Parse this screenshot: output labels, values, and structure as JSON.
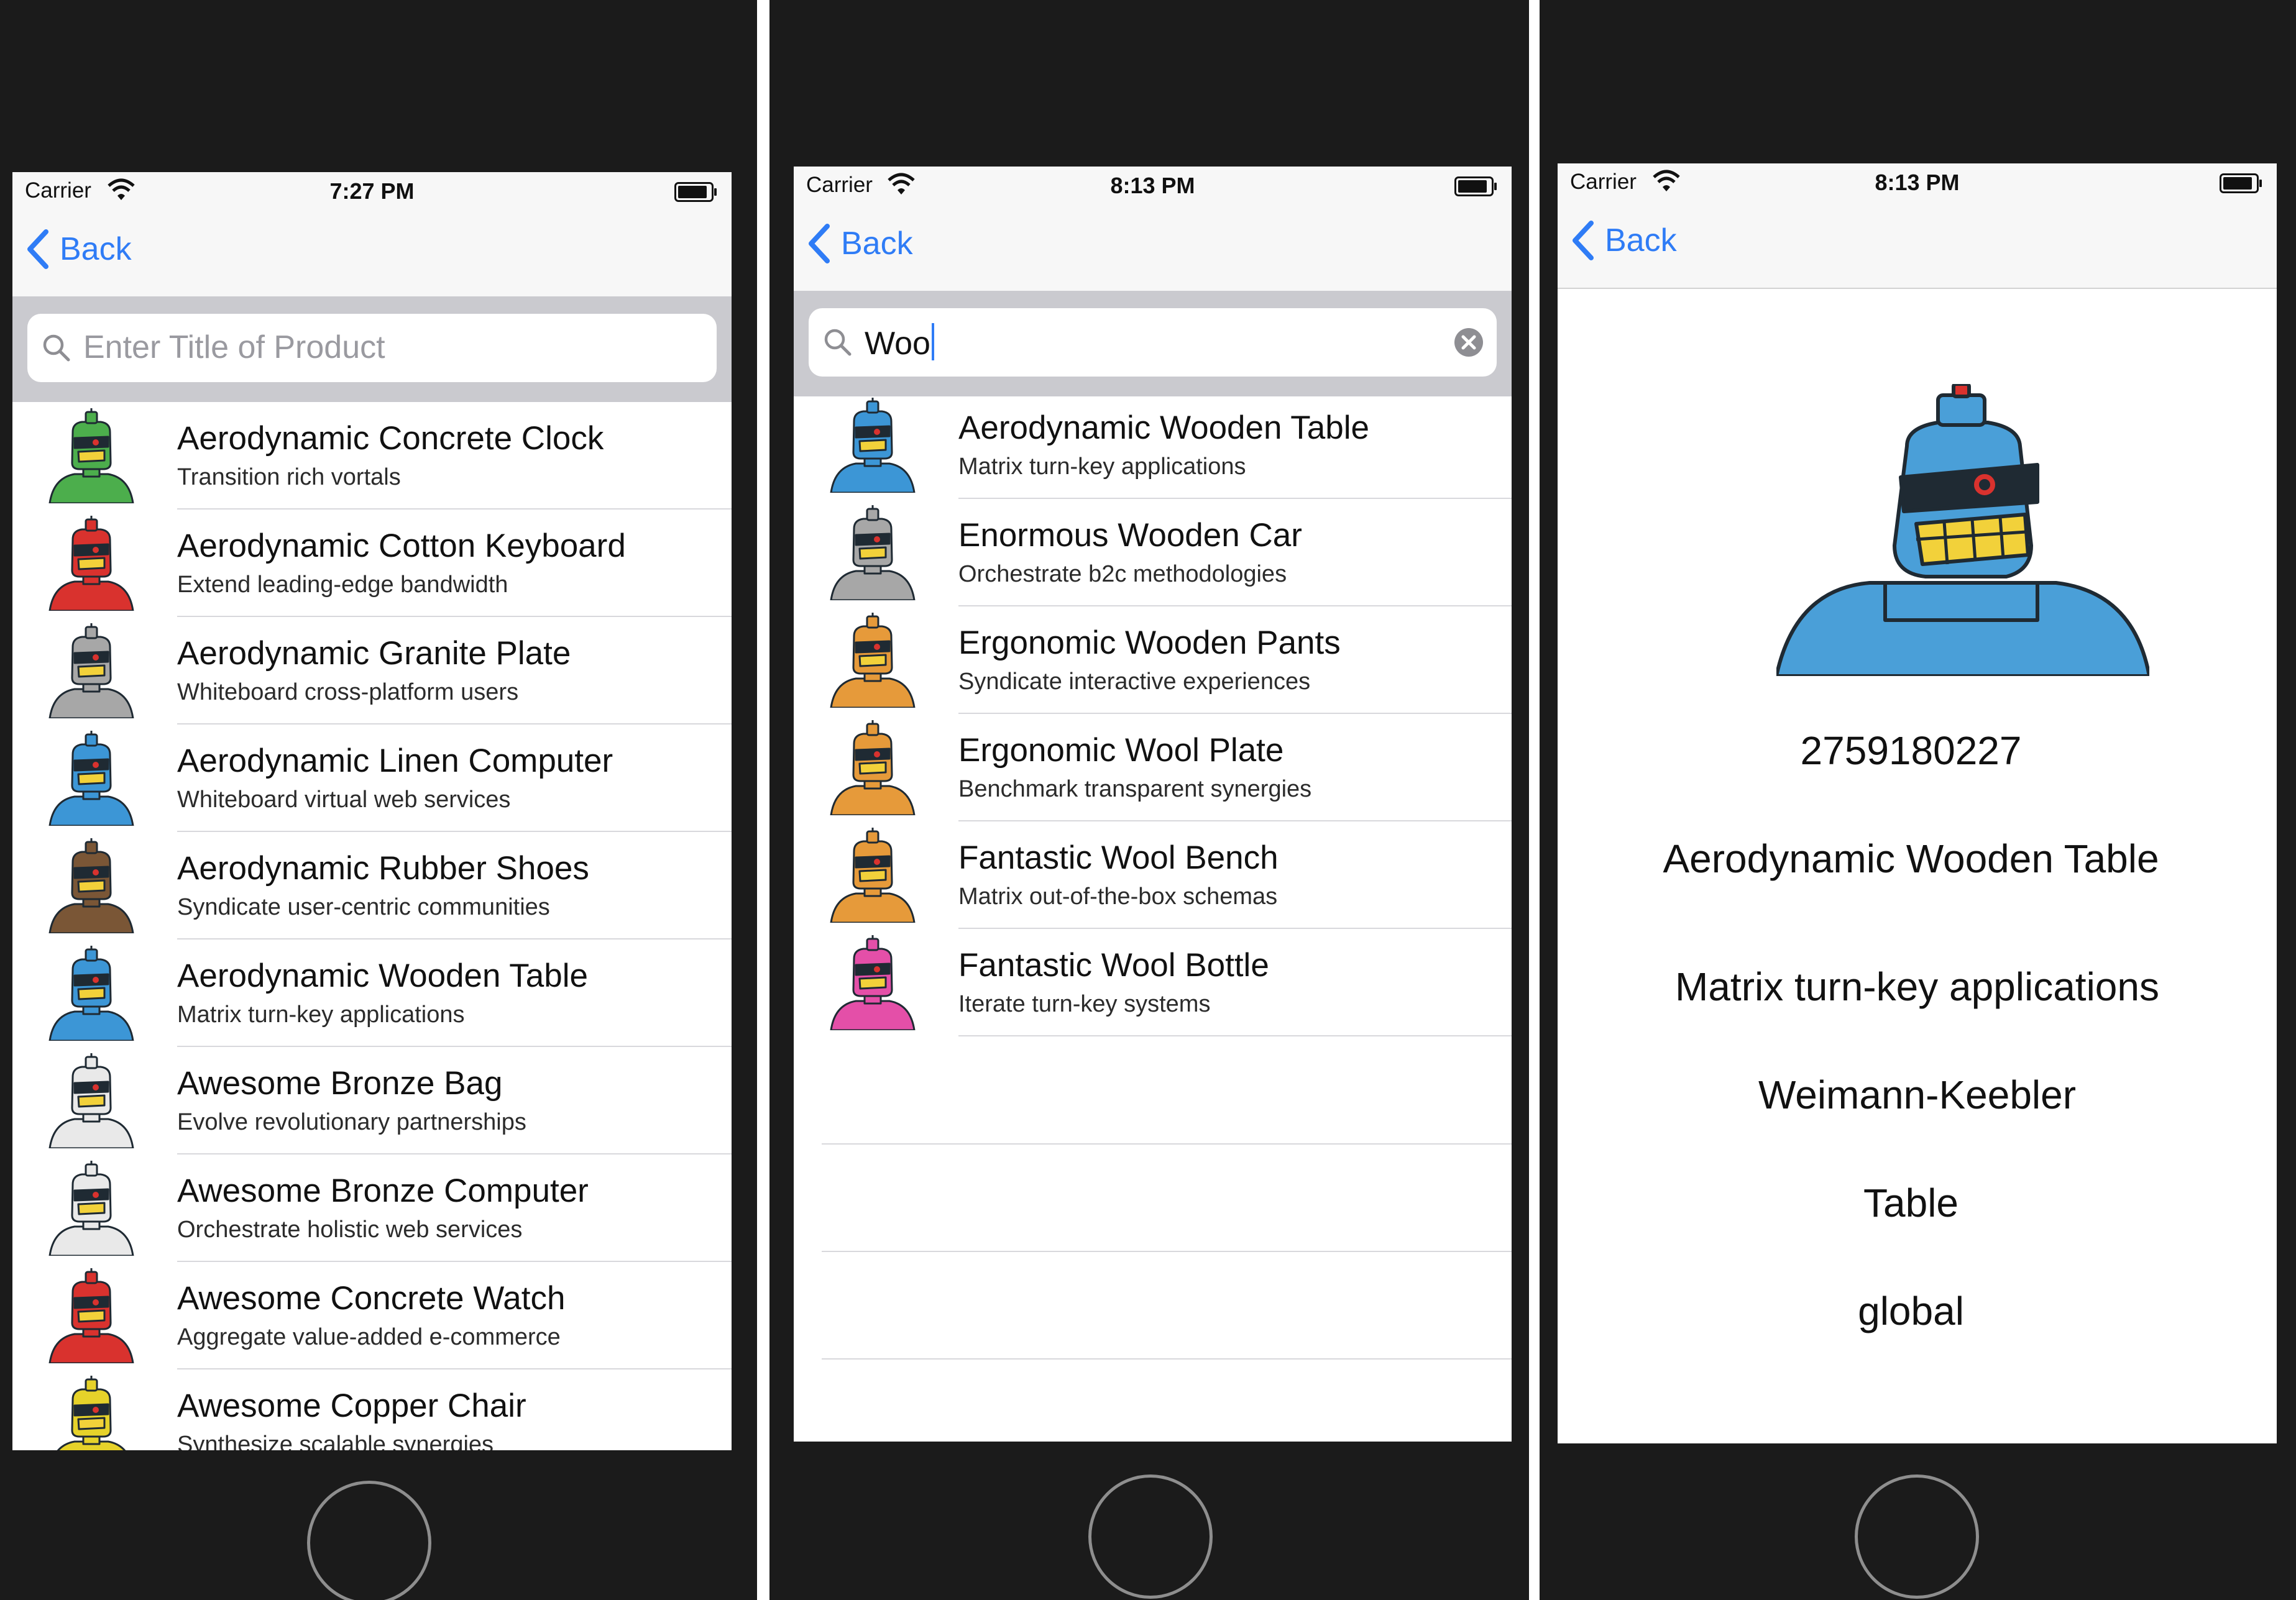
{
  "status": {
    "carrier": "Carrier"
  },
  "nav": {
    "back_label": "Back"
  },
  "screen1": {
    "time": "7:27 PM",
    "search_placeholder": "Enter Title of Product",
    "rows": [
      {
        "title": "Aerodynamic Concrete Clock",
        "subtitle": "Transition rich vortals",
        "color": "#4cae4c"
      },
      {
        "title": "Aerodynamic Cotton Keyboard",
        "subtitle": "Extend leading-edge bandwidth",
        "color": "#d9322e"
      },
      {
        "title": "Aerodynamic Granite Plate",
        "subtitle": "Whiteboard cross-platform users",
        "color": "#a7a7a7"
      },
      {
        "title": "Aerodynamic Linen Computer",
        "subtitle": "Whiteboard virtual web services",
        "color": "#3c96d6"
      },
      {
        "title": "Aerodynamic Rubber Shoes",
        "subtitle": "Syndicate user-centric communities",
        "color": "#7a5636"
      },
      {
        "title": "Aerodynamic Wooden Table",
        "subtitle": "Matrix turn-key applications",
        "color": "#3c96d6"
      },
      {
        "title": "Awesome Bronze Bag",
        "subtitle": "Evolve revolutionary partnerships",
        "color": "#e9e9e9"
      },
      {
        "title": "Awesome Bronze Computer",
        "subtitle": "Orchestrate holistic web services",
        "color": "#e9e9e9"
      },
      {
        "title": "Awesome Concrete Watch",
        "subtitle": "Aggregate value-added e-commerce",
        "color": "#d9322e"
      },
      {
        "title": "Awesome Copper Chair",
        "subtitle": "Synthesize scalable synergies",
        "color": "#e6d22a"
      }
    ]
  },
  "screen2": {
    "time": "8:13 PM",
    "search_value": "Woo",
    "rows": [
      {
        "title": "Aerodynamic Wooden Table",
        "subtitle": "Matrix turn-key applications",
        "color": "#3c96d6"
      },
      {
        "title": "Enormous Wooden Car",
        "subtitle": "Orchestrate b2c methodologies",
        "color": "#a7a7a7"
      },
      {
        "title": "Ergonomic Wooden Pants",
        "subtitle": "Syndicate interactive experiences",
        "color": "#e69a3a"
      },
      {
        "title": "Ergonomic Wool Plate",
        "subtitle": "Benchmark transparent synergies",
        "color": "#e69a3a"
      },
      {
        "title": "Fantastic Wool Bench",
        "subtitle": "Matrix out-of-the-box schemas",
        "color": "#e69a3a"
      },
      {
        "title": "Fantastic Wool Bottle",
        "subtitle": "Iterate turn-key systems",
        "color": "#e44fa8"
      }
    ]
  },
  "screen3": {
    "time": "8:13 PM",
    "robot_color": "#4a9fd8",
    "id": "2759180227",
    "title": "Aerodynamic Wooden Table",
    "description": "Matrix turn-key applications",
    "company": "Weimann-Keebler",
    "category": "Table",
    "scope": "global"
  }
}
